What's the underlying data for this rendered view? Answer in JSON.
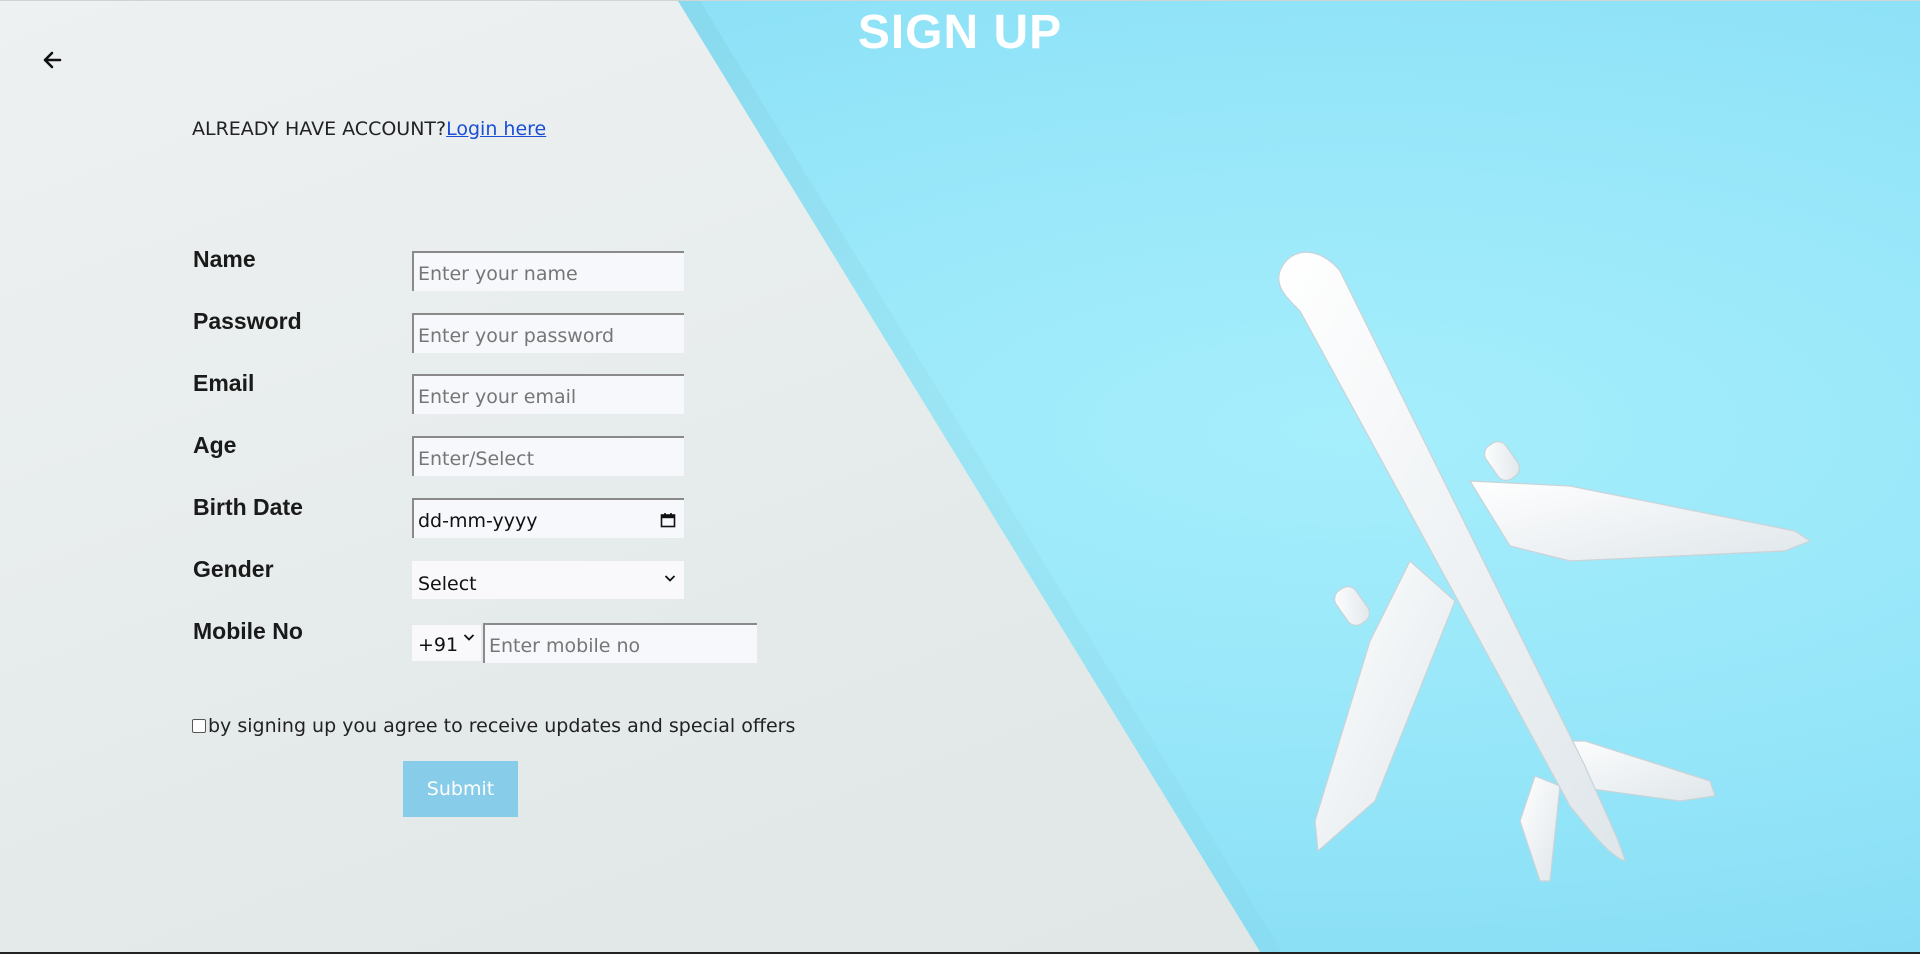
{
  "header": {
    "title": "SIGN UP"
  },
  "account": {
    "prompt": "ALREADY HAVE ACCOUNT?",
    "login_link": "Login here"
  },
  "form": {
    "name": {
      "label": "Name",
      "placeholder": "Enter your name"
    },
    "password": {
      "label": "Password",
      "placeholder": "Enter your password"
    },
    "email": {
      "label": "Email",
      "placeholder": "Enter your email"
    },
    "age": {
      "label": "Age",
      "placeholder": "Enter/Select"
    },
    "birth_date": {
      "label": "Birth Date",
      "value": "dd-mm-yyyy"
    },
    "gender": {
      "label": "Gender",
      "selected": "Select"
    },
    "mobile": {
      "label": "Mobile No",
      "country_code": "+91",
      "placeholder": "Enter mobile no"
    },
    "consent_text": "by signing up you agree to receive updates and special offers",
    "submit_label": "Submit"
  },
  "icons": {
    "back": "arrow-left-icon",
    "calendar": "calendar-icon",
    "dropdown": "chevron-down-icon"
  },
  "colors": {
    "title": "#ffffff",
    "link": "#1a4fd6",
    "submit_bg": "#87cdea",
    "panel_blue": "#96e6f9",
    "panel_grey": "#e9eeee"
  }
}
